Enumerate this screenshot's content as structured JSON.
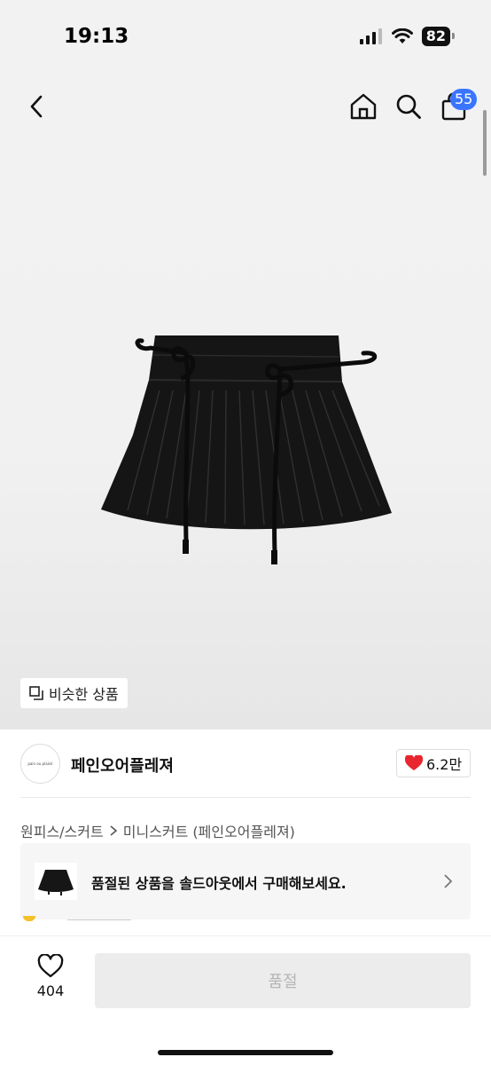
{
  "status_bar": {
    "time": "19:13",
    "battery": "82"
  },
  "header": {
    "back_icon": "chevron-left-icon",
    "home_icon": "home-icon",
    "search_icon": "search-icon",
    "cart_icon": "shopping-bag-icon",
    "cart_badge": "55"
  },
  "product": {
    "image_alt_icon": "pleated-mini-skirt",
    "similar_button_label": "비슷한 상품"
  },
  "shop": {
    "logo_text": "pain ou plaisir",
    "name": "페인오어플레져",
    "likes": "6.2만",
    "heart_color": "#e8262f"
  },
  "breadcrumb": {
    "category": "원피스/스커트",
    "subcategory": "미니스커트 (페인오어플레져)"
  },
  "soldout_banner": {
    "text": "품절된 상품을 솔드아웃에서 구매해보세요."
  },
  "bottom": {
    "wish_count": "404",
    "buy_label": "품절"
  },
  "colors": {
    "accent": "#3a75ff"
  }
}
